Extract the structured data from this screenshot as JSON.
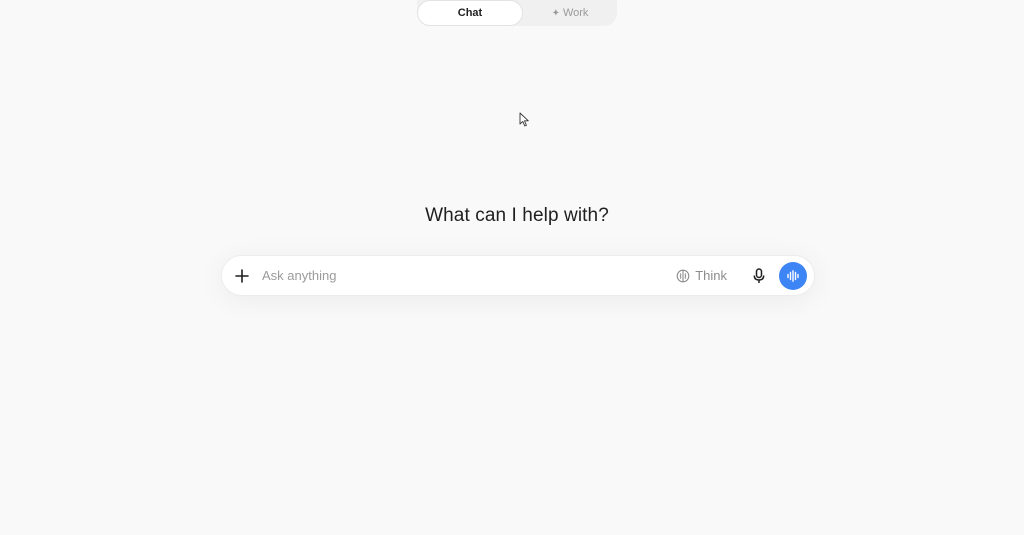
{
  "mode_toggle": {
    "active_tab": "Chat",
    "inactive_tab": "Work",
    "inactive_icon": "sparkle-icon"
  },
  "heading": "What can I help with?",
  "composer": {
    "attach_icon": "plus-icon",
    "placeholder": "Ask anything",
    "value": "",
    "think_icon": "brain-icon",
    "think_label": "Think",
    "mic_icon": "microphone-icon",
    "voice_icon": "voice-waveform-icon"
  },
  "colors": {
    "background": "#f9f9f9",
    "accent": "#3d84f5",
    "muted_text": "#9b9b9b"
  }
}
